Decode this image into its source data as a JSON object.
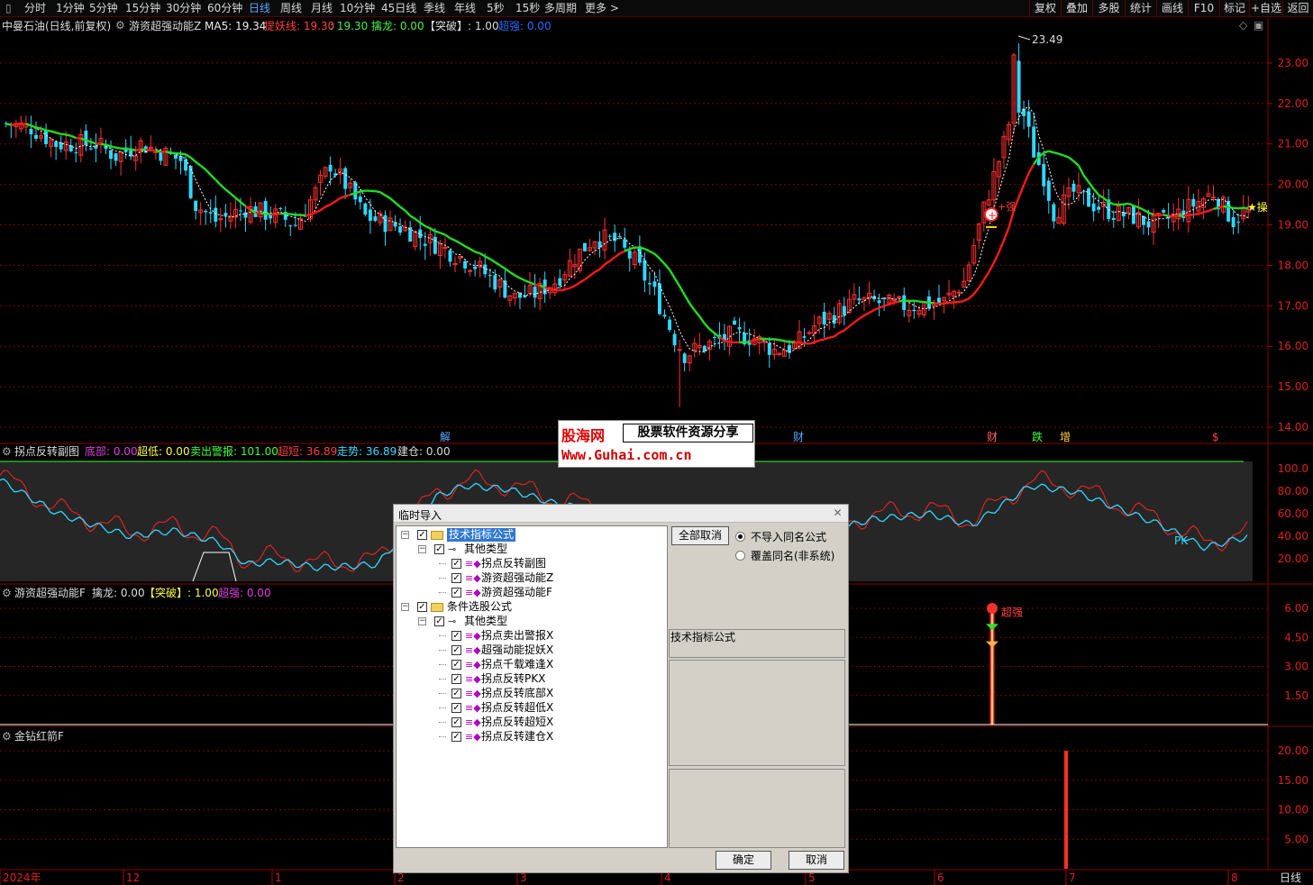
{
  "toolbar": {
    "periods": [
      "分时",
      "1分钟",
      "5分钟",
      "15分钟",
      "30分钟",
      "60分钟",
      "日线",
      "周线",
      "月线",
      "10分钟",
      "45日线",
      "季线",
      "年线",
      "5秒",
      "15秒",
      "多周期",
      "更多 >"
    ],
    "active": "日线",
    "right": [
      "复权",
      "叠加",
      "多股",
      "统计",
      "画线",
      "F10",
      "标记",
      "+自选",
      "返回"
    ]
  },
  "main": {
    "stock": "中曼石油(日线,前复权)",
    "indicator": "游资超强动能Z",
    "ma5": "MA5: 19.34",
    "tiyao": "提妖线: 19.30",
    "v2": ": 19.30",
    "qinlong": "擒龙: 0.00",
    "tupo": "【突破】: 1.00",
    "chaoqiang": "超强: 0.00",
    "peak": "23.49",
    "price_ticks": [
      "23.00",
      "22.00",
      "21.00",
      "20.00",
      "19.00",
      "18.00",
      "17.00",
      "16.00",
      "15.00",
      "14.00"
    ],
    "events": [
      "解",
      "财",
      "财",
      "跌",
      "增",
      "$"
    ],
    "star_label": "★操",
    "red_label": "+强"
  },
  "sub1": {
    "name": "拐点反转副图",
    "dibu": "底部: 0.00",
    "chaodi": "超低: 0.00",
    "maichu": "卖出警报: 101.00",
    "chaoduan": "超短: 36.89",
    "zoushi": "走势: 36.89",
    "jiancang": "建仓: 0.00",
    "ticks": [
      "100.0",
      "80.00",
      "60.00",
      "40.00",
      "20.00"
    ],
    "pk": "PK"
  },
  "sub2": {
    "name": "游资超强动能F",
    "qinlong": "擒龙: 0.00",
    "tupo": "【突破】: 1.00",
    "chaoqiang": "超强: 0.00",
    "ticks": [
      "6.00",
      "4.50",
      "3.00",
      "1.50"
    ],
    "marker": "超强"
  },
  "sub3": {
    "name": "金钻红箭F",
    "ticks": [
      "20.00",
      "15.00",
      "10.00",
      "5.00"
    ]
  },
  "xaxis": {
    "labels": [
      "2024年",
      "12",
      "1",
      "2",
      "3",
      "4",
      "5",
      "6",
      "7",
      "8"
    ],
    "period": "日线"
  },
  "watermark": {
    "brand": "股海网",
    "slogan": "股票软件资源分享",
    "url": "Www.Guhai.com.cn"
  },
  "dialog": {
    "title": "临时导入",
    "btn_cancel_all": "全部取消",
    "radio1": "不导入同名公式",
    "radio2": "覆盖同名(非系统)",
    "info": "技术指标公式",
    "ok": "确定",
    "cancel": "取消",
    "tree": [
      {
        "l": 0,
        "exp": "-",
        "folder": true,
        "text": "技术指标公式",
        "sel": true
      },
      {
        "l": 1,
        "exp": "-",
        "key": true,
        "text": "其他类型"
      },
      {
        "l": 2,
        "gem": true,
        "text": "拐点反转副图"
      },
      {
        "l": 2,
        "gem": true,
        "text": "游资超强动能Z"
      },
      {
        "l": 2,
        "gem": true,
        "text": "游资超强动能F"
      },
      {
        "l": 0,
        "exp": "-",
        "folder": true,
        "text": "条件选股公式"
      },
      {
        "l": 1,
        "exp": "-",
        "key": true,
        "text": "其他类型"
      },
      {
        "l": 2,
        "gem": true,
        "text": "拐点卖出警报X"
      },
      {
        "l": 2,
        "gem": true,
        "text": "超强动能捉妖X"
      },
      {
        "l": 2,
        "gem": true,
        "text": "拐点千载难逢X"
      },
      {
        "l": 2,
        "gem": true,
        "text": "拐点反转PKX"
      },
      {
        "l": 2,
        "gem": true,
        "text": "拐点反转底部X"
      },
      {
        "l": 2,
        "gem": true,
        "text": "拐点反转超低X"
      },
      {
        "l": 2,
        "gem": true,
        "text": "拐点反转超短X"
      },
      {
        "l": 2,
        "gem": true,
        "text": "拐点反转建仓X"
      }
    ]
  },
  "chart_data": {
    "type": "candlestick",
    "ylim": [
      13.6,
      23.8
    ],
    "peak": 23.49,
    "waypoints": [
      [
        0,
        21.5
      ],
      [
        5,
        21.4
      ],
      [
        10,
        21.0
      ],
      [
        18,
        21.0
      ],
      [
        22,
        20.7
      ],
      [
        27,
        21.0
      ],
      [
        31,
        20.8
      ],
      [
        35,
        20.6
      ],
      [
        38,
        19.5
      ],
      [
        42,
        19.1
      ],
      [
        48,
        19.4
      ],
      [
        55,
        19.2
      ],
      [
        58,
        19.0
      ],
      [
        62,
        19.8
      ],
      [
        65,
        20.5
      ],
      [
        68,
        20.0
      ],
      [
        72,
        19.2
      ],
      [
        80,
        18.9
      ],
      [
        88,
        18.4
      ],
      [
        94,
        18.0
      ],
      [
        98,
        17.6
      ],
      [
        102,
        17.2
      ],
      [
        106,
        17.3
      ],
      [
        110,
        17.6
      ],
      [
        114,
        18.2
      ],
      [
        118,
        18.7
      ],
      [
        122,
        18.6
      ],
      [
        126,
        18.1
      ],
      [
        130,
        17.3
      ],
      [
        134,
        16.2
      ],
      [
        136,
        15.8
      ],
      [
        140,
        16.0
      ],
      [
        146,
        16.3
      ],
      [
        150,
        16.2
      ],
      [
        154,
        15.9
      ],
      [
        158,
        16.0
      ],
      [
        162,
        16.5
      ],
      [
        166,
        16.8
      ],
      [
        170,
        17.1
      ],
      [
        174,
        17.1
      ],
      [
        178,
        17.0
      ],
      [
        182,
        17.0
      ],
      [
        188,
        17.1
      ],
      [
        192,
        17.6
      ],
      [
        196,
        19.4
      ],
      [
        198,
        20.2
      ],
      [
        200,
        21.0
      ],
      [
        202,
        22.0
      ],
      [
        204,
        21.7
      ],
      [
        206,
        20.8
      ],
      [
        208,
        20.2
      ],
      [
        210,
        19.3
      ],
      [
        214,
        19.8
      ],
      [
        218,
        19.5
      ],
      [
        222,
        19.3
      ],
      [
        226,
        19.2
      ],
      [
        230,
        19.0
      ],
      [
        234,
        19.2
      ],
      [
        238,
        19.5
      ],
      [
        242,
        19.8
      ],
      [
        246,
        19.1
      ],
      [
        248,
        19.3
      ]
    ]
  }
}
